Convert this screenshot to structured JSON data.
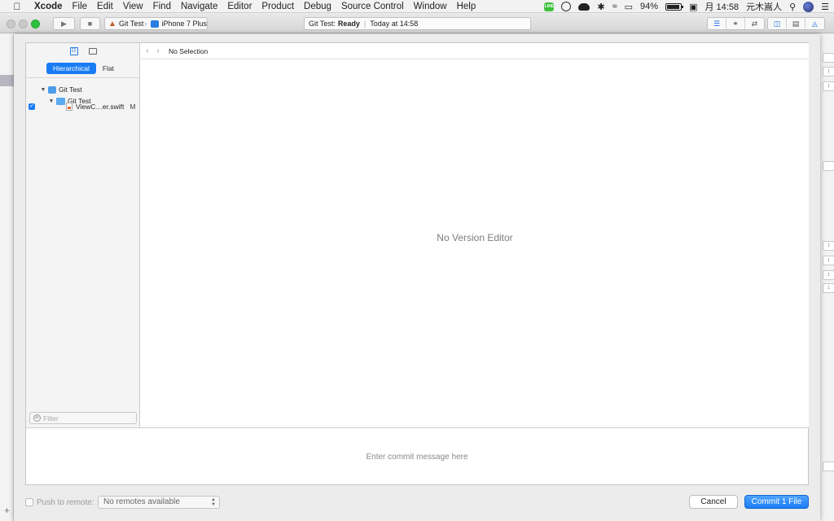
{
  "menubar": {
    "app_name": "Xcode",
    "items": [
      "File",
      "Edit",
      "View",
      "Find",
      "Navigate",
      "Editor",
      "Product",
      "Debug",
      "Source Control",
      "Window",
      "Help"
    ],
    "status": {
      "line_label": "LINE",
      "battery_percent": "94%",
      "battery_level": 0.94,
      "clock": "月 14:58",
      "user": "元木嵩人"
    }
  },
  "toolbar": {
    "scheme_name": "Git Test",
    "device_name": "iPhone 7 Plus",
    "activity_name": "Git Test:",
    "activity_state": "Ready",
    "activity_time": "Today at 14:58"
  },
  "navigator": {
    "tabs": [
      "Hierarchical",
      "Flat"
    ],
    "selected_tab": "Hierarchical",
    "project_name": "Git Test",
    "group_name": "Git Test",
    "file_name": "ViewC…er.swift",
    "file_status": "M",
    "filter_placeholder": "Filter"
  },
  "editor": {
    "jump_crumb": "No Selection",
    "empty_message": "No Version Editor"
  },
  "commit": {
    "message_placeholder": "Enter commit message here",
    "push_label": "Push to remote:",
    "remotes_value": "No remotes available",
    "cancel_label": "Cancel",
    "commit_label": "Commit 1 File"
  },
  "colors": {
    "accent": "#1a7cf3",
    "zoom_button": "#2cc13f",
    "line_app": "#3ec13e"
  }
}
